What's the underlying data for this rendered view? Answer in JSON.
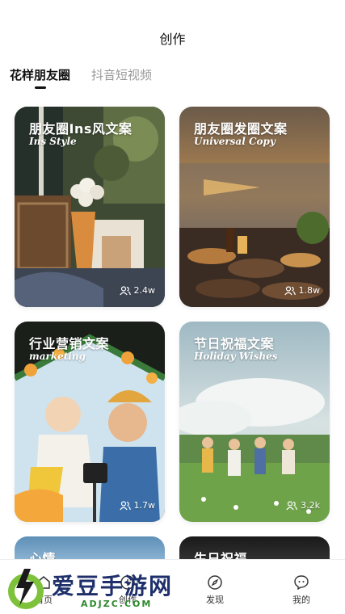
{
  "header": {
    "title": "创作"
  },
  "tabs": [
    {
      "label": "花样朋友圈",
      "active": true
    },
    {
      "label": "抖音短视频",
      "active": false
    }
  ],
  "cards": [
    {
      "title": "朋友圈Ins风文案",
      "subtitle": "Ins Style",
      "count": "2.4w"
    },
    {
      "title": "朋友圈发圈文案",
      "subtitle": "Universal Copy",
      "count": "1.8w"
    },
    {
      "title": "行业营销文案",
      "subtitle": "marketing",
      "count": "1.7w"
    },
    {
      "title": "节日祝福文案",
      "subtitle": "Holiday Wishes",
      "count": "3.2k"
    },
    {
      "title": "心情",
      "subtitle": "",
      "count": ""
    },
    {
      "title": "生日祝福",
      "subtitle": "",
      "count": ""
    }
  ],
  "bottom_nav": [
    {
      "label": "首页",
      "icon": "home-icon"
    },
    {
      "label": "创作",
      "icon": "create-icon"
    },
    {
      "label": "发现",
      "icon": "compass-icon"
    },
    {
      "label": "我的",
      "icon": "profile-icon"
    }
  ],
  "watermark": {
    "text": "爱豆手游网",
    "url": "ADJZC.COM"
  },
  "colors": {
    "accent": "#111111",
    "inactive_tab": "#999999",
    "watermark_blue": "#1e2f6b",
    "watermark_green": "#2c8a2c"
  }
}
